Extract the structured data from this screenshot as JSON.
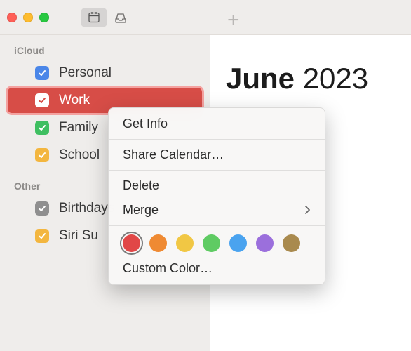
{
  "titlebar": {
    "traffic": [
      "close",
      "minimize",
      "zoom"
    ]
  },
  "sidebar": {
    "sections": [
      {
        "title": "iCloud",
        "items": [
          {
            "label": "Personal",
            "color": "#4a86e8",
            "checked": true,
            "selected": false
          },
          {
            "label": "Work",
            "color": "#ffffff",
            "checked": true,
            "selected": true,
            "bg": "#d74d47"
          },
          {
            "label": "Family",
            "color": "#3fbf61",
            "checked": true,
            "selected": false
          },
          {
            "label": "School",
            "color": "#f3b63f",
            "checked": true,
            "selected": false
          }
        ]
      },
      {
        "title": "Other",
        "items": [
          {
            "label": "Birthdays",
            "color": "#8f8f8f",
            "checked": true,
            "selected": false
          },
          {
            "label": "Siri Suggestions",
            "color": "#f3b63f",
            "checked": true,
            "selected": false,
            "truncated": "Siri Su"
          }
        ]
      }
    ]
  },
  "main": {
    "month": "June",
    "year": "2023"
  },
  "contextMenu": {
    "items": {
      "getInfo": "Get Info",
      "share": "Share Calendar…",
      "delete": "Delete",
      "merge": "Merge",
      "customColor": "Custom Color…"
    },
    "colors": [
      {
        "hex": "#e14747",
        "selected": true
      },
      {
        "hex": "#ef8a33",
        "selected": false
      },
      {
        "hex": "#f1c744",
        "selected": false
      },
      {
        "hex": "#5fcb63",
        "selected": false
      },
      {
        "hex": "#4aa3ef",
        "selected": false
      },
      {
        "hex": "#9b6fdc",
        "selected": false
      },
      {
        "hex": "#a98a4e",
        "selected": false
      }
    ]
  }
}
